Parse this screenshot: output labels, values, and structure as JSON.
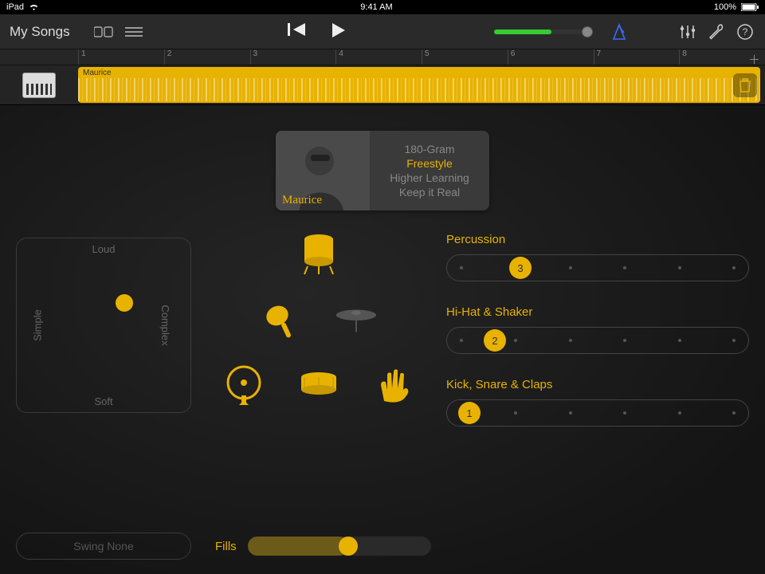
{
  "status": {
    "device": "iPad",
    "time": "9:41 AM",
    "battery": "100%"
  },
  "toolbar": {
    "back_label": "My Songs"
  },
  "ruler": {
    "bars": [
      "1",
      "2",
      "3",
      "4",
      "5",
      "6",
      "7",
      "8"
    ]
  },
  "track": {
    "region_name": "Maurice"
  },
  "drummer": {
    "name": "Maurice",
    "presets": [
      "180-Gram",
      "Freestyle",
      "Higher Learning",
      "Keep it Real"
    ],
    "selected_preset": "Freestyle"
  },
  "xy": {
    "top": "Loud",
    "bottom": "Soft",
    "left": "Simple",
    "right": "Complex"
  },
  "sliders": {
    "percussion": {
      "label": "Percussion",
      "value": 3,
      "max": 6
    },
    "hihat": {
      "label": "Hi-Hat & Shaker",
      "value": 2,
      "max": 6
    },
    "kick": {
      "label": "Kick, Snare & Claps",
      "value": 1,
      "max": 6
    }
  },
  "swing": {
    "label": "Swing None"
  },
  "fills": {
    "label": "Fills",
    "value_percent": 55
  },
  "colors": {
    "accent": "#e8b200"
  }
}
